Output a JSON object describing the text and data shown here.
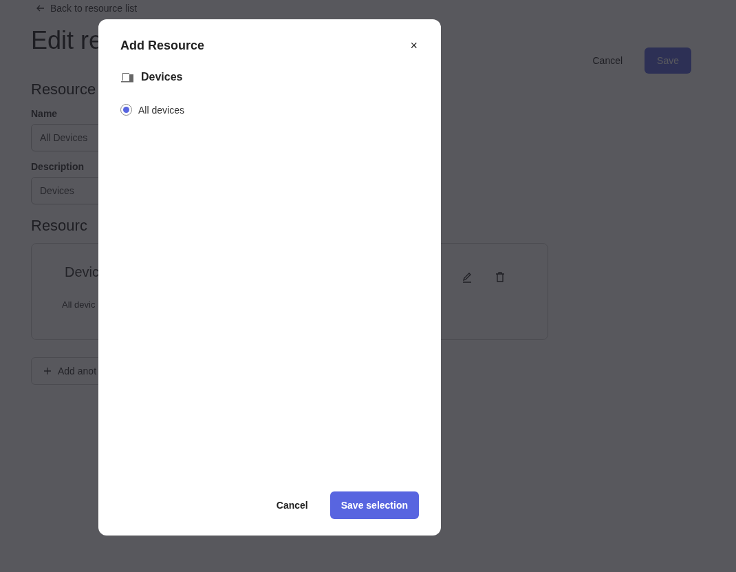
{
  "page": {
    "back_link": "Back to resource list",
    "title": "Edit re",
    "actions": {
      "cancel": "Cancel",
      "save": "Save"
    },
    "details": {
      "heading": "Resource",
      "fields": [
        {
          "label": "Name",
          "value": "All Devices"
        },
        {
          "label": "Description",
          "value": "Devices"
        }
      ]
    },
    "resources": {
      "heading": "Resourc",
      "cards": [
        {
          "title": "Devic",
          "description": "All devic"
        }
      ],
      "add_button": "Add anot"
    }
  },
  "modal": {
    "title": "Add Resource",
    "close": "×",
    "section": "Devices",
    "options": [
      {
        "label": "All devices",
        "selected": true
      }
    ],
    "buttons": {
      "cancel": "Cancel",
      "save": "Save selection"
    }
  }
}
